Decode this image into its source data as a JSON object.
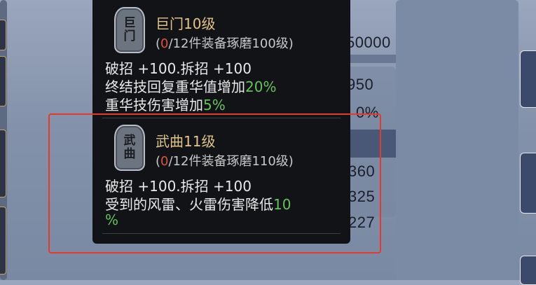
{
  "background": {
    "numbers": [
      "50000",
      "950",
      "0%",
      "360",
      "325",
      "227"
    ]
  },
  "tooltip": {
    "set1": {
      "badge_chars": [
        "巨",
        "门"
      ],
      "title": "巨门10级",
      "req_open": "(",
      "req_count": "0",
      "req_rest": "/12件装备琢磨100级)",
      "line1": "破招 +100.拆招 +100",
      "line2_text": "终结技回复重华值增加",
      "line2_value": "20%",
      "line3_text": "重华技伤害增加",
      "line3_value": "5%"
    },
    "set2": {
      "badge_chars": [
        "武",
        "曲"
      ],
      "title": "武曲11级",
      "req_open": "(",
      "req_count": "0",
      "req_rest": "/12件装备琢磨110级)",
      "line1": "破招 +100.拆招 +100",
      "line2_text": "受到的风雷、火雷伤害降低",
      "line2_value": "10",
      "line3_value": "%"
    }
  },
  "colors": {
    "title_gold": "#e2c488",
    "value_green": "#66c25a",
    "count_red": "#e0513e",
    "highlight_red": "#e23a2c"
  }
}
